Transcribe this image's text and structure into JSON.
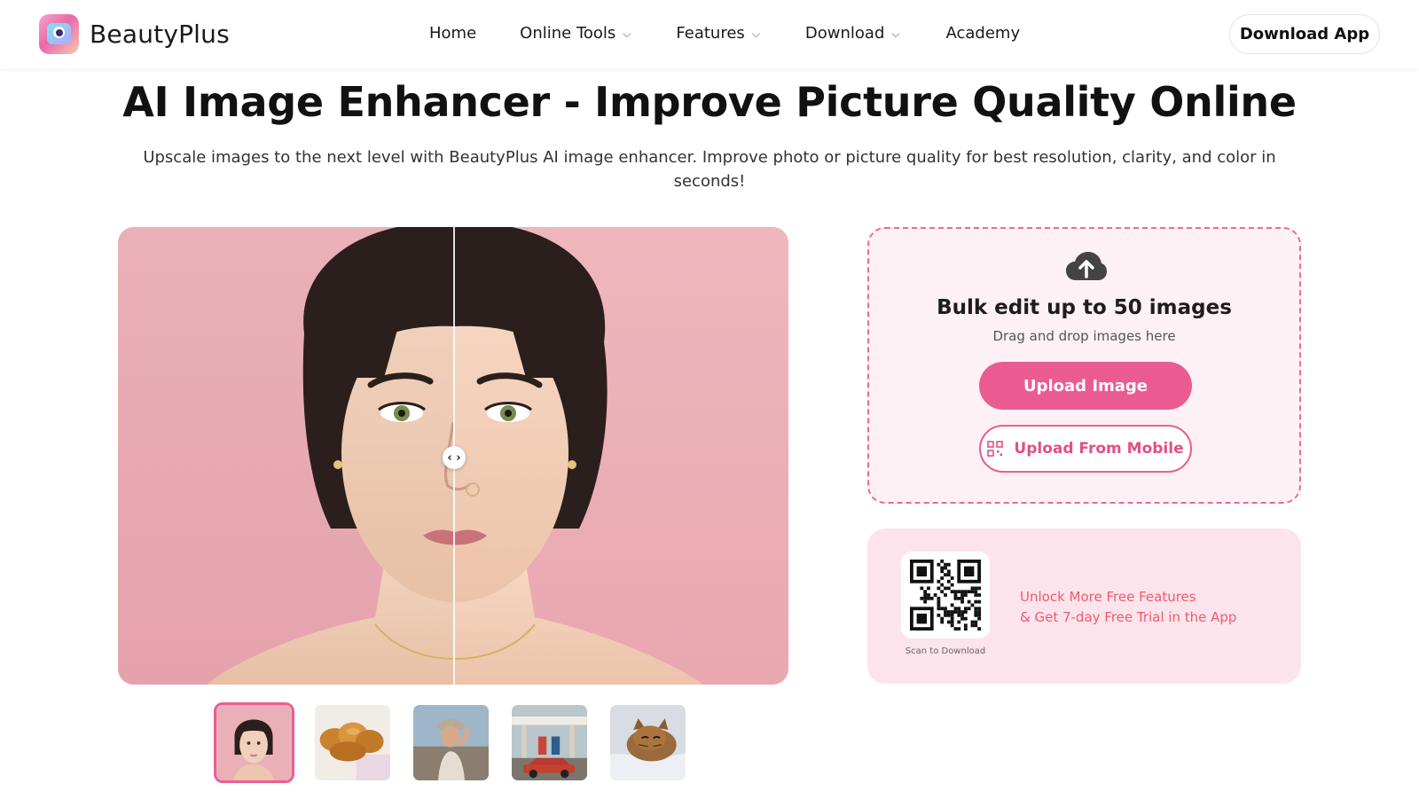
{
  "brand": {
    "name": "BeautyPlus",
    "logo_icon": "camera-eye-icon",
    "accent": "#ea5c91"
  },
  "nav": {
    "items": [
      {
        "label": "Home",
        "has_dropdown": false
      },
      {
        "label": "Online Tools",
        "has_dropdown": true
      },
      {
        "label": "Features",
        "has_dropdown": true
      },
      {
        "label": "Download",
        "has_dropdown": true
      },
      {
        "label": "Academy",
        "has_dropdown": false
      }
    ],
    "chevron": "⌵",
    "cta": "Download App"
  },
  "hero": {
    "title": "AI Image Enhancer - Improve Picture Quality Online",
    "subtitle": "Upscale images to the next level with BeautyPlus AI image enhancer. Improve photo or picture quality for best resolution, clarity, and color in seconds!"
  },
  "viewer": {
    "handle_glyph": "‹ ›",
    "split_position": 0.5
  },
  "thumbnails": [
    {
      "subject": "portrait",
      "selected": true
    },
    {
      "subject": "bread",
      "selected": false
    },
    {
      "subject": "woman-outdoors",
      "selected": false
    },
    {
      "subject": "gas-station",
      "selected": false
    },
    {
      "subject": "cat",
      "selected": false
    }
  ],
  "upload": {
    "icon": "cloud-upload-icon",
    "title": "Bulk edit up to 50 images",
    "hint": "Drag and drop images here",
    "primary_button": "Upload Image",
    "secondary_button": "Upload From Mobile",
    "secondary_icon": "qr-code-icon"
  },
  "promo": {
    "qr_caption": "Scan to Download",
    "line1": "Unlock More Free Features",
    "line2": "& Get 7-day Free Trial in the App"
  }
}
